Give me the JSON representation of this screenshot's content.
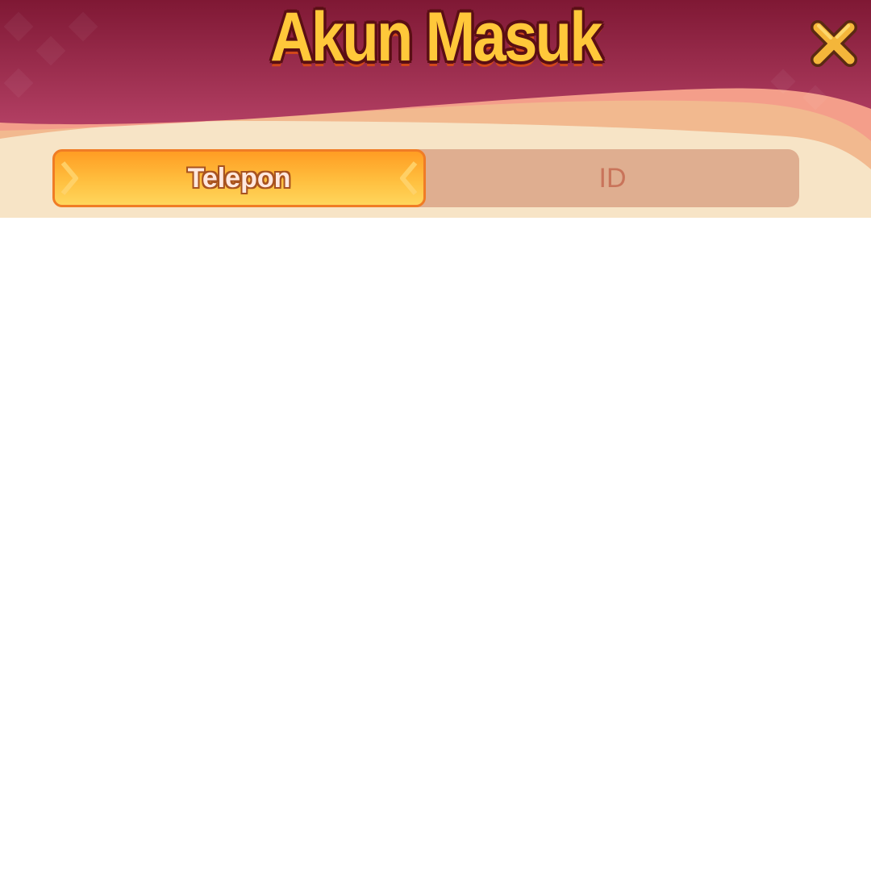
{
  "dialog": {
    "title": "Akun Masuk",
    "close_icon": "close-icon"
  },
  "tabs": [
    {
      "label": "Telepon",
      "active": true
    },
    {
      "label": "ID",
      "active": false
    }
  ],
  "colors": {
    "header": "#8a1c36",
    "panel": "#f7e4c6",
    "tab_active": "#ffb02e",
    "tab_track": "#dfae90",
    "title_fill": "#ffc83a"
  }
}
